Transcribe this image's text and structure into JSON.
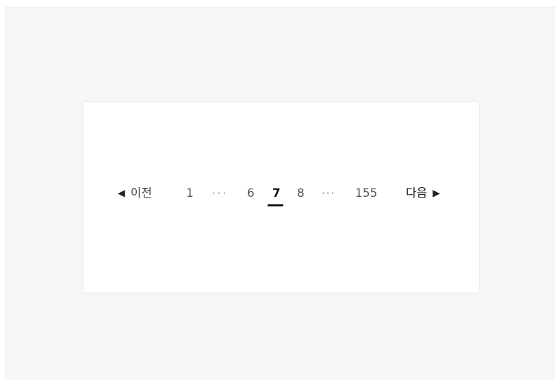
{
  "pagination": {
    "prev_label": "이전",
    "prev_icon": "triangle-left-icon",
    "next_label": "다음",
    "next_icon": "triangle-right-icon",
    "pages": {
      "first": "1",
      "ellipsis_left": "···",
      "p6": "6",
      "current": "7",
      "p8": "8",
      "ellipsis_right": "···",
      "last": "155"
    },
    "current_page": 7,
    "total_pages": 155
  },
  "colors": {
    "background": "#f6f6f6",
    "card": "#ffffff",
    "active": "#111111",
    "text": "#555555"
  }
}
